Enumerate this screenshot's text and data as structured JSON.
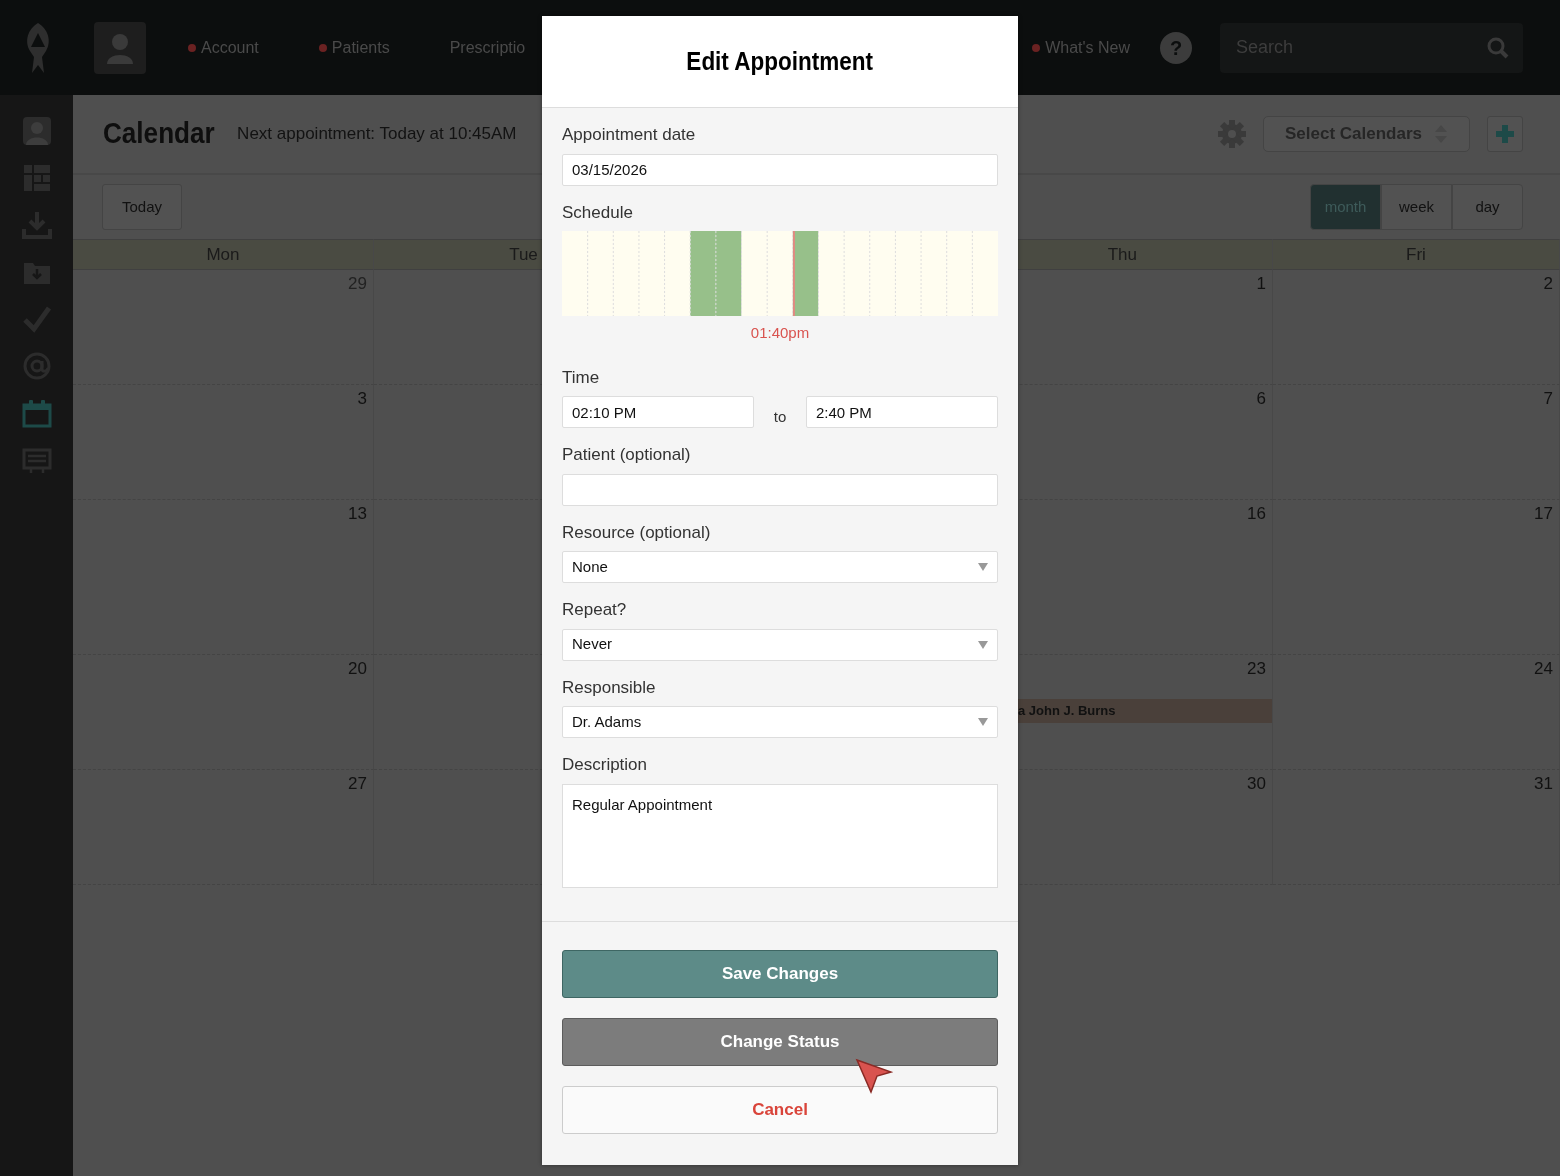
{
  "nav": {
    "items": [
      {
        "label": "Account",
        "dot": true
      },
      {
        "label": "Patients",
        "dot": true
      },
      {
        "label": "Prescriptio",
        "dot": false
      },
      {
        "label": "What's New",
        "dot": true
      }
    ],
    "help": "?",
    "search": {
      "placeholder": "Search"
    }
  },
  "sidebar": {
    "items": [
      {
        "kind": "avatar",
        "selected": false
      },
      {
        "kind": "grid",
        "selected": false
      },
      {
        "kind": "download",
        "selected": false
      },
      {
        "kind": "folder",
        "selected": false
      },
      {
        "kind": "check",
        "selected": false
      },
      {
        "kind": "at",
        "selected": false
      },
      {
        "kind": "calendar",
        "selected": true
      },
      {
        "kind": "screen",
        "selected": false
      }
    ]
  },
  "calendar": {
    "title": "Calendar",
    "next_appointment": "Next appointment: Today at 10:45AM",
    "today_button": "Today",
    "select_calendars": "Select Calendars",
    "views": [
      {
        "label": "month",
        "selected": true
      },
      {
        "label": "week",
        "selected": false
      },
      {
        "label": "day",
        "selected": false
      }
    ],
    "weekdays": [
      "Mon",
      "Tue",
      "Thu",
      "Fri"
    ],
    "weeks": [
      {
        "cells": [
          {
            "day": "29",
            "other_month": true
          },
          {},
          {
            "day": "1",
            "other_month": false
          },
          {
            "day": "2",
            "other_month": false
          }
        ]
      },
      {
        "cells": [
          {
            "day": "3",
            "other_month": false
          },
          {},
          {
            "day": "6",
            "other_month": false
          },
          {
            "day": "7",
            "other_month": false
          }
        ]
      },
      {
        "cells": [
          {
            "day": "13",
            "other_month": false
          },
          {},
          {
            "day": "16",
            "other_month": false
          },
          {
            "day": "17",
            "other_month": false
          }
        ]
      },
      {
        "cells": [
          {
            "day": "20",
            "other_month": false
          },
          {},
          {
            "day": "23",
            "other_month": false,
            "event": "a John J. Burns"
          },
          {
            "day": "24",
            "other_month": false
          }
        ]
      },
      {
        "cells": [
          {
            "day": "27",
            "other_month": false
          },
          {},
          {
            "day": "30",
            "other_month": false
          },
          {
            "day": "31",
            "other_month": false
          }
        ]
      }
    ]
  },
  "modal": {
    "title": "Edit Appointment",
    "fields": [
      {
        "kind": "text",
        "label": "Appointment date",
        "value": "03/15/2026"
      },
      {
        "kind": "schedule",
        "label": "Schedule",
        "time": "01:40pm",
        "level": 0.532,
        "slots": [
          {
            "busy": false
          },
          {
            "busy": false
          },
          {
            "busy": false
          },
          {
            "busy": false
          },
          {
            "busy": false
          },
          {
            "busy": true
          },
          {
            "busy": true
          },
          {
            "busy": false
          },
          {
            "busy": false
          },
          {
            "busy": true
          },
          {
            "busy": false
          },
          {
            "busy": false
          },
          {
            "busy": false
          },
          {
            "busy": false
          },
          {
            "busy": false
          },
          {
            "busy": false
          },
          {
            "busy": false
          }
        ]
      },
      {
        "kind": "time_range",
        "label": "Time",
        "from": "02:10 PM",
        "separator": "to",
        "to": "2:40 PM"
      },
      {
        "kind": "text",
        "label": "Patient (optional)"
      },
      {
        "kind": "select",
        "label": "Resource (optional)",
        "value": "None"
      },
      {
        "kind": "select",
        "label": "Repeat?",
        "value": "Never"
      },
      {
        "kind": "select",
        "label": "Responsible",
        "value": "Dr. Adams"
      },
      {
        "kind": "textarea",
        "label": "Description",
        "value": "Regular Appointment"
      }
    ],
    "buttons": [
      {
        "kind": "primary",
        "label": "Save Changes"
      },
      {
        "kind": "secondary",
        "label": "Change Status"
      },
      {
        "kind": "cancel",
        "label": "Cancel"
      }
    ]
  }
}
